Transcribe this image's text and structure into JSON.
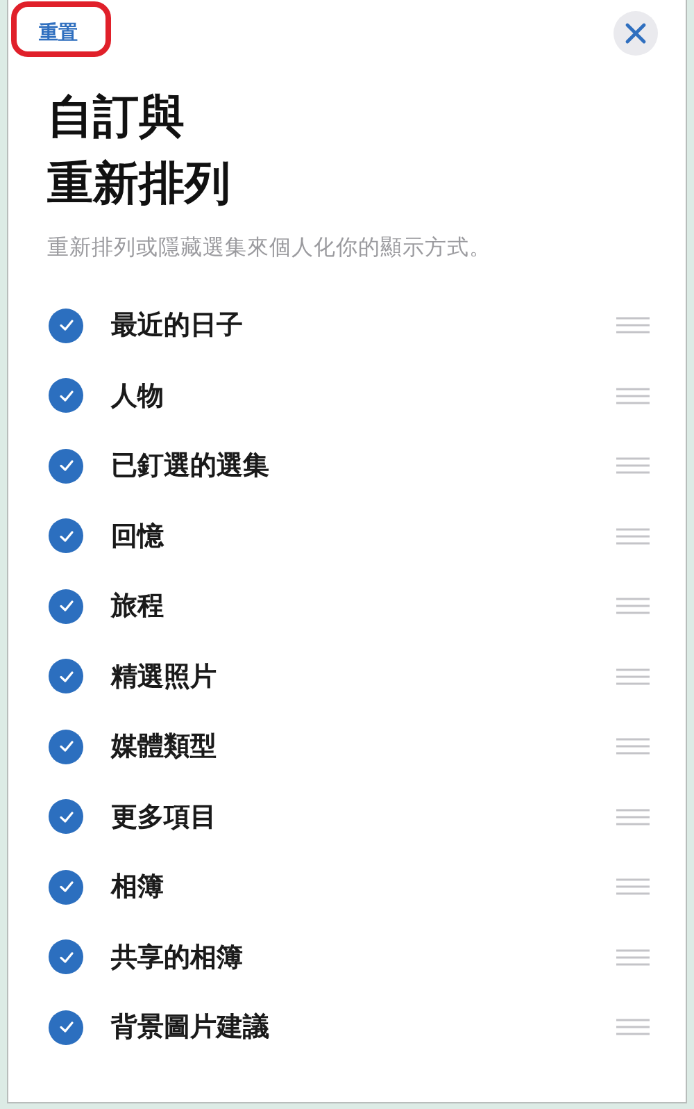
{
  "header": {
    "reset_button": "重置",
    "reset_highlighted": true
  },
  "title_lines": [
    "自訂與",
    "重新排列"
  ],
  "subtitle": "重新排列或隱藏選集來個人化你的顯示方式。",
  "items": [
    {
      "label": "最近的日子",
      "checked": true
    },
    {
      "label": "人物",
      "checked": true
    },
    {
      "label": "已釘選的選集",
      "checked": true
    },
    {
      "label": "回憶",
      "checked": true
    },
    {
      "label": "旅程",
      "checked": true
    },
    {
      "label": "精選照片",
      "checked": true
    },
    {
      "label": "媒體類型",
      "checked": true
    },
    {
      "label": "更多項目",
      "checked": true
    },
    {
      "label": "相簿",
      "checked": true
    },
    {
      "label": "共享的相簿",
      "checked": true
    },
    {
      "label": "背景圖片建議",
      "checked": true
    }
  ]
}
